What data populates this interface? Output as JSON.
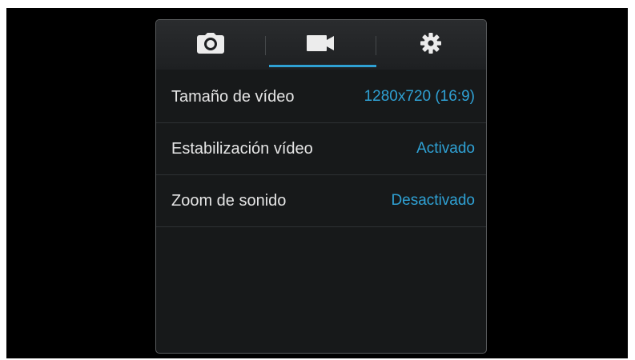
{
  "colors": {
    "background": "#000000",
    "panel": "#17191a",
    "accent": "#2fa1d4",
    "label_text": "#e6e6e6"
  },
  "tabs": [
    {
      "icon": "camera-icon",
      "selected": false
    },
    {
      "icon": "video-camera-icon",
      "selected": true
    },
    {
      "icon": "gear-icon",
      "selected": false
    }
  ],
  "settings": [
    {
      "label": "Tamaño de vídeo",
      "value": "1280x720 (16:9)"
    },
    {
      "label": "Estabilización vídeo",
      "value": "Activado"
    },
    {
      "label": "Zoom de sonido",
      "value": "Desactivado"
    }
  ]
}
